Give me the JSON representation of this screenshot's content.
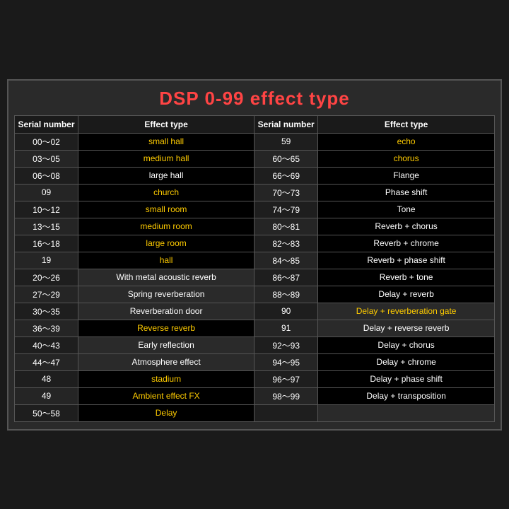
{
  "title": "DSP 0-99 effect type",
  "table": {
    "headers": [
      "Serial number",
      "Effect type",
      "Serial number",
      "Effect type"
    ],
    "rows": [
      {
        "s1": "00～02",
        "e1": "small hall",
        "e1_style": "yellow",
        "s2": "59",
        "e2": "echo",
        "e2_style": "yellow"
      },
      {
        "s1": "03～05",
        "e1": "medium hall",
        "e1_style": "yellow",
        "s2": "60～65",
        "e2": "chorus",
        "e2_style": "yellow"
      },
      {
        "s1": "06～08",
        "e1": "large hall",
        "e1_style": "white",
        "s2": "66～69",
        "e2": "Flange",
        "e2_style": "white"
      },
      {
        "s1": "09",
        "e1": "church",
        "e1_style": "yellow",
        "s2": "70～73",
        "e2": "Phase shift",
        "e2_style": "white"
      },
      {
        "s1": "10～12",
        "e1": "small room",
        "e1_style": "yellow",
        "s2": "74～79",
        "e2": "Tone",
        "e2_style": "white"
      },
      {
        "s1": "13～15",
        "e1": "medium room",
        "e1_style": "yellow",
        "s2": "80～81",
        "e2": "Reverb + chorus",
        "e2_style": "white"
      },
      {
        "s1": "16～18",
        "e1": "large room",
        "e1_style": "yellow",
        "s2": "82～83",
        "e2": "Reverb + chrome",
        "e2_style": "white"
      },
      {
        "s1": "19",
        "e1": "hall",
        "e1_style": "yellow",
        "s2": "84～85",
        "e2": "Reverb + phase shift",
        "e2_style": "white"
      },
      {
        "s1": "20～26",
        "e1": "With metal acoustic reverb",
        "e1_style": "nobg_white",
        "s2": "86～87",
        "e2": "Reverb + tone",
        "e2_style": "white"
      },
      {
        "s1": "27～29",
        "e1": "Spring reverberation",
        "e1_style": "nobg_white",
        "s2": "88～89",
        "e2": "Delay + reverb",
        "e2_style": "white"
      },
      {
        "s1": "30～35",
        "e1": "Reverberation door",
        "e1_style": "nobg_white",
        "s2": "90",
        "e2": "Delay + reverberation gate",
        "e2_style": "nobg_yellow"
      },
      {
        "s1": "36～39",
        "e1": "Reverse reverb",
        "e1_style": "yellow",
        "s2": "91",
        "e2": "Delay + reverse reverb",
        "e2_style": "nobg_white"
      },
      {
        "s1": "40～43",
        "e1": "Early reflection",
        "e1_style": "nobg_white",
        "s2": "92～93",
        "e2": "Delay + chorus",
        "e2_style": "white"
      },
      {
        "s1": "44～47",
        "e1": "Atmosphere effect",
        "e1_style": "nobg_white",
        "s2": "94～95",
        "e2": "Delay + chrome",
        "e2_style": "white"
      },
      {
        "s1": "48",
        "e1": "stadium",
        "e1_style": "yellow",
        "s2": "96～97",
        "e2": "Delay + phase shift",
        "e2_style": "white"
      },
      {
        "s1": "49",
        "e1": "Ambient effect FX",
        "e1_style": "yellow",
        "s2": "98～99",
        "e2": "Delay + transposition",
        "e2_style": "white"
      },
      {
        "s1": "50～58",
        "e1": "Delay",
        "e1_style": "yellow",
        "s2": "",
        "e2": "",
        "e2_style": "empty"
      }
    ]
  }
}
